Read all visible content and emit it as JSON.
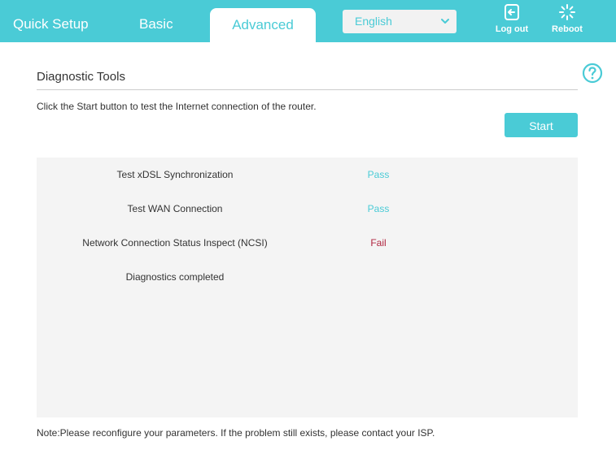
{
  "nav": {
    "tabs": [
      {
        "label": "Quick Setup",
        "active": false
      },
      {
        "label": "Basic",
        "active": false
      },
      {
        "label": "Advanced",
        "active": true
      }
    ],
    "language": {
      "selected": "English"
    },
    "actions": {
      "logout_label": "Log out",
      "reboot_label": "Reboot"
    }
  },
  "colors": {
    "accent": "#4acbd6",
    "fail": "#b0243f",
    "panel_bg": "#f4f4f4"
  },
  "icons": {
    "logout": "logout-icon",
    "reboot": "reboot-icon",
    "help": "help-icon",
    "dropdown": "chevron-down-icon"
  },
  "main": {
    "title": "Diagnostic Tools",
    "instruction": "Click the Start button to test the Internet connection of the router.",
    "start_label": "Start",
    "results": [
      {
        "label": "Test xDSL Synchronization",
        "status": "Pass",
        "state": "pass"
      },
      {
        "label": "Test WAN Connection",
        "status": "Pass",
        "state": "pass"
      },
      {
        "label": "Network Connection Status Inspect (NCSI)",
        "status": "Fail",
        "state": "fail"
      },
      {
        "label": "Diagnostics completed",
        "status": "",
        "state": "none"
      }
    ],
    "note": "Note:Please reconfigure your parameters. If the problem still exists, please contact your ISP."
  }
}
